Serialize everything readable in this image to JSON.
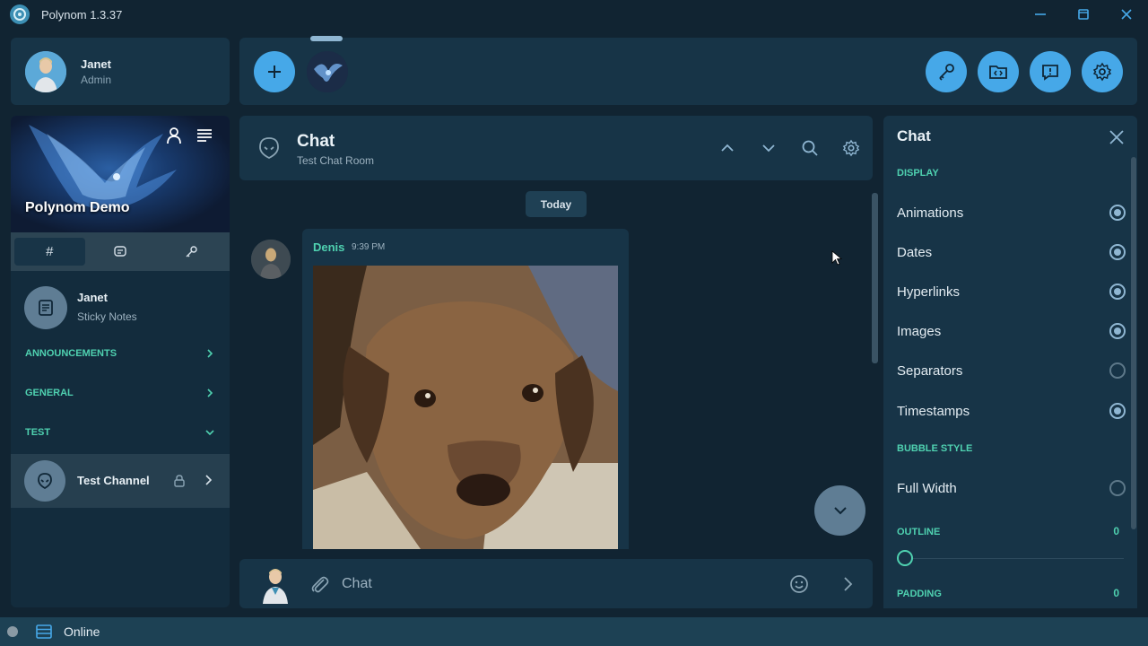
{
  "window": {
    "title": "Polynom 1.3.37"
  },
  "user": {
    "name": "Janet",
    "role": "Admin"
  },
  "server": {
    "name": "Polynom Demo"
  },
  "sidebar": {
    "tabs": [
      {
        "label": "#"
      },
      {
        "icon": "chat-bubble-icon"
      },
      {
        "icon": "key-icon"
      }
    ],
    "note": {
      "name": "Janet",
      "subtitle": "Sticky Notes"
    },
    "categories": [
      {
        "name": "ANNOUNCEMENTS",
        "expanded": false
      },
      {
        "name": "GENERAL",
        "expanded": false
      },
      {
        "name": "TEST",
        "expanded": true
      }
    ],
    "channel": {
      "name": "Test Channel"
    }
  },
  "chat": {
    "title": "Chat",
    "subtitle": "Test Chat Room",
    "date_divider": "Today",
    "message": {
      "author": "Denis",
      "time": "9:39 PM"
    },
    "input_placeholder": "Chat"
  },
  "settings": {
    "title": "Chat",
    "display_section": "DISPLAY",
    "display_options": [
      {
        "label": "Animations",
        "checked": true
      },
      {
        "label": "Dates",
        "checked": true
      },
      {
        "label": "Hyperlinks",
        "checked": true
      },
      {
        "label": "Images",
        "checked": true
      },
      {
        "label": "Separators",
        "checked": false
      },
      {
        "label": "Timestamps",
        "checked": true
      }
    ],
    "bubble_section": "BUBBLE STYLE",
    "bubble_options": [
      {
        "label": "Full Width",
        "checked": false
      }
    ],
    "outline": {
      "label": "OUTLINE",
      "value": "0"
    },
    "padding": {
      "label": "PADDING",
      "value": "0"
    }
  },
  "status": {
    "text": "Online"
  },
  "colors": {
    "accent": "#46a8e8",
    "teal": "#4fd1b0",
    "panel": "#173447",
    "background": "#112432"
  }
}
